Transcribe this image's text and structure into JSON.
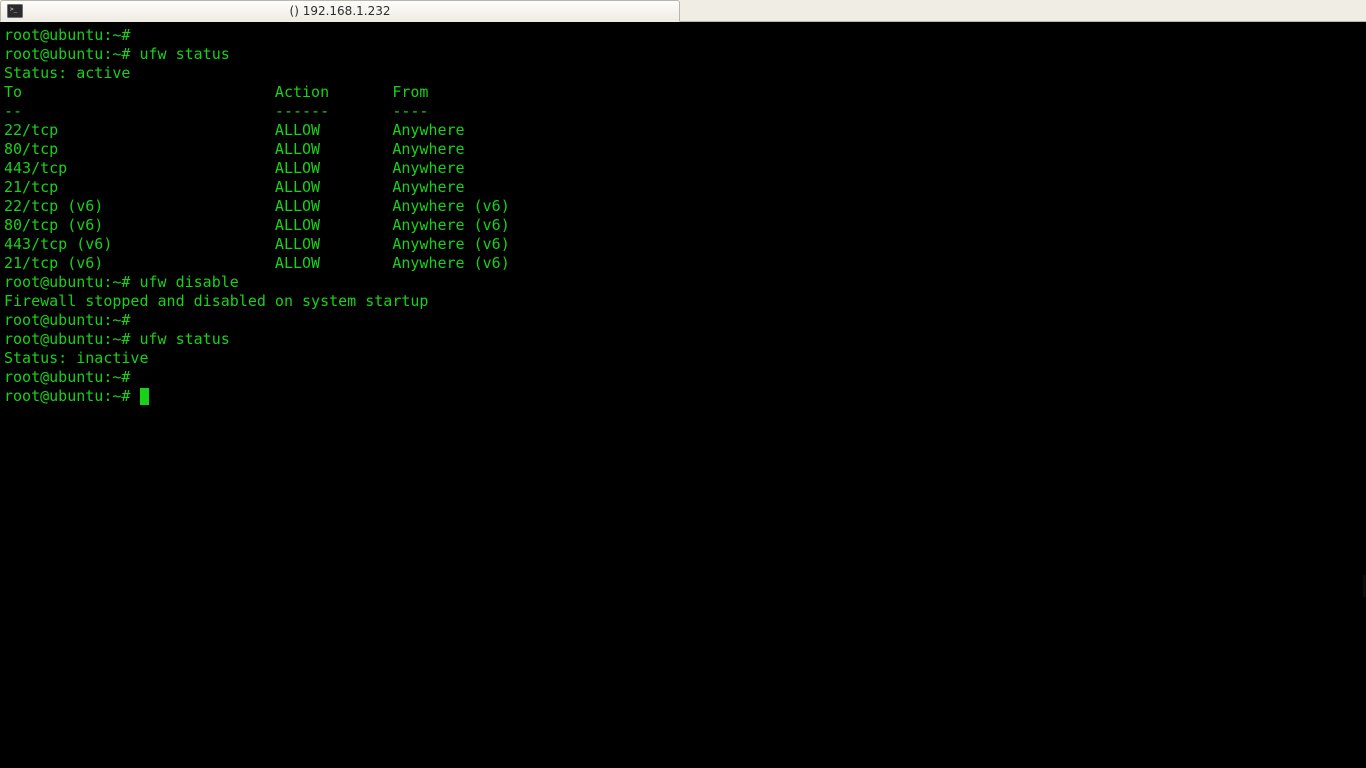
{
  "tabbar": {
    "tab1": {
      "icon_name": "terminal-icon",
      "title": "() 192.168.1.232"
    }
  },
  "terminal": {
    "prompt": "root@ubuntu:~#",
    "lines": [
      {
        "type": "prompt",
        "cmd": ""
      },
      {
        "type": "prompt",
        "cmd": "ufw status"
      },
      {
        "type": "out",
        "text": "Status: active"
      },
      {
        "type": "blank"
      },
      {
        "type": "table_header",
        "to": "To",
        "action": "Action",
        "from": "From"
      },
      {
        "type": "table_divider",
        "to": "--",
        "action": "------",
        "from": "----"
      },
      {
        "type": "rule",
        "to": "22/tcp",
        "action": "ALLOW",
        "from": "Anywhere"
      },
      {
        "type": "rule",
        "to": "80/tcp",
        "action": "ALLOW",
        "from": "Anywhere"
      },
      {
        "type": "rule",
        "to": "443/tcp",
        "action": "ALLOW",
        "from": "Anywhere"
      },
      {
        "type": "rule",
        "to": "21/tcp",
        "action": "ALLOW",
        "from": "Anywhere"
      },
      {
        "type": "rule",
        "to": "22/tcp (v6)",
        "action": "ALLOW",
        "from": "Anywhere (v6)"
      },
      {
        "type": "rule",
        "to": "80/tcp (v6)",
        "action": "ALLOW",
        "from": "Anywhere (v6)"
      },
      {
        "type": "rule",
        "to": "443/tcp (v6)",
        "action": "ALLOW",
        "from": "Anywhere (v6)"
      },
      {
        "type": "rule",
        "to": "21/tcp (v6)",
        "action": "ALLOW",
        "from": "Anywhere (v6)"
      },
      {
        "type": "blank"
      },
      {
        "type": "prompt",
        "cmd": "ufw disable"
      },
      {
        "type": "out",
        "text": "Firewall stopped and disabled on system startup"
      },
      {
        "type": "prompt",
        "cmd": ""
      },
      {
        "type": "prompt",
        "cmd": "ufw status"
      },
      {
        "type": "out",
        "text": "Status: inactive"
      },
      {
        "type": "prompt",
        "cmd": ""
      },
      {
        "type": "prompt_cursor",
        "cmd": ""
      }
    ],
    "col_widths": {
      "to": 30,
      "action": 13
    }
  }
}
